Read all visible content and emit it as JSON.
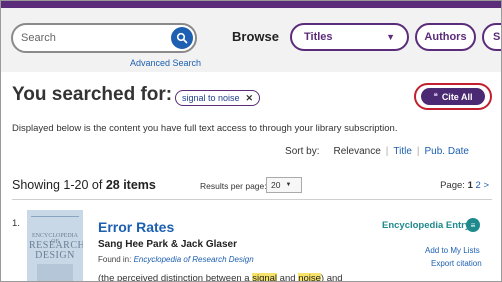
{
  "header": {
    "search": {
      "placeholder": "Search",
      "value": ""
    },
    "advanced_search": "Advanced Search",
    "browse_label": "Browse",
    "browse_select": {
      "selected": "Titles"
    },
    "authors_button": "Authors",
    "partial_button": "S"
  },
  "query": {
    "heading": "You searched for:",
    "term": "signal to noise",
    "remove_glyph": "✕",
    "cite_all": "Cite All"
  },
  "access_notice": "Displayed below is the content you have full text access to through your library subscription.",
  "sort": {
    "label": "Sort by:",
    "options": [
      "Relevance",
      "Title",
      "Pub. Date"
    ],
    "active": "Relevance"
  },
  "results_meta": {
    "showing_prefix": "Showing 1-20 of ",
    "count": "28 items",
    "per_page_label": "Results per page:",
    "per_page_value": "20",
    "page_label": "Page:",
    "current_page": "1",
    "next_page": "2",
    "next_arrow": ">"
  },
  "results": [
    {
      "number": "1.",
      "title": "Error Rates",
      "authors": "Sang Hee Park & Jack Glaser",
      "found_prefix": "Found in: ",
      "found_source": "Encyclopedia of Research Design",
      "snippet_parts": [
        "(the perceived distinction between a ",
        "signal",
        " and ",
        "noise",
        ") and"
      ],
      "type": "Encyclopedia Entry",
      "add_to_lists": "Add to My Lists",
      "export_citation": "Export citation",
      "cover": {
        "line1": "ENCYCLOPEDIA OF",
        "line2": "RESEARCH",
        "line3": "DESIGN"
      }
    }
  ],
  "colors": {
    "brand_purple": "#5b2c7a",
    "link_blue": "#1d5fb0",
    "highlight_red": "#c21f2f",
    "teal": "#1e8a8e",
    "snippet_highlight": "#f7e36a"
  }
}
